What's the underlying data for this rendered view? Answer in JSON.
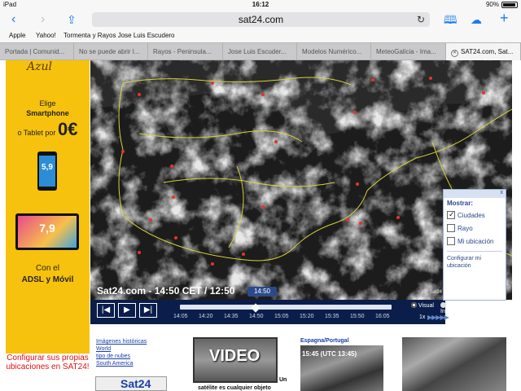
{
  "status": {
    "device": "iPad",
    "time": "16:12",
    "battery": "90%"
  },
  "nav": {
    "url": "sat24.com"
  },
  "bookmarks": [
    "Apple",
    "Yahoo!",
    "Tormenta y Rayos Jose Luis Escudero"
  ],
  "tabs": [
    "Portada | Comunid...",
    "No se puede abrir l...",
    "Rayos - Peninsula...",
    "Jose Luis Escuder...",
    "Modelos Numérico...",
    "MeteoGalicia - Ima...",
    "SAT24.com, Sat..."
  ],
  "ad": {
    "brand": "Azul",
    "line1": "Elige",
    "line2": "Smartphone",
    "line3": "o Tablet por",
    "price": "0€",
    "phone_label": "5,9",
    "tablet_label": "7,9",
    "footer1": "Con el",
    "footer2": "ADSL y Móvil",
    "configure": "Configurar sus propias ubicaciones en SAT24!"
  },
  "map": {
    "caption": "Sat24.com - 14:50 CET / 12:50",
    "copyright": "(C) Sat24",
    "current_time": "14:50",
    "times": [
      "14:05",
      "14:20",
      "14:35",
      "14:50",
      "15:05",
      "15:20",
      "15:35",
      "15:50",
      "16:05"
    ],
    "current_index": 3,
    "mode_visual": "Visual",
    "mode_infrared": "Infrarojos",
    "speed": "1x"
  },
  "options": {
    "title": "Mostrar:",
    "close": "x",
    "cities": "Ciudades",
    "lightning": "Rayo",
    "location": "Mi ubicación",
    "configure": "Configurar mi ubicación",
    "cities_checked": true
  },
  "links": [
    "Imágenes históricas",
    "World",
    "tipo de nubes",
    "South America"
  ],
  "logo": "Sat24",
  "video": {
    "label": "VIDEO",
    "un": "Un",
    "caption": "satélite es cualquier objeto"
  },
  "spain": {
    "title": "Espagna/Portugal",
    "time": "15:45 (UTC 13:45)"
  }
}
